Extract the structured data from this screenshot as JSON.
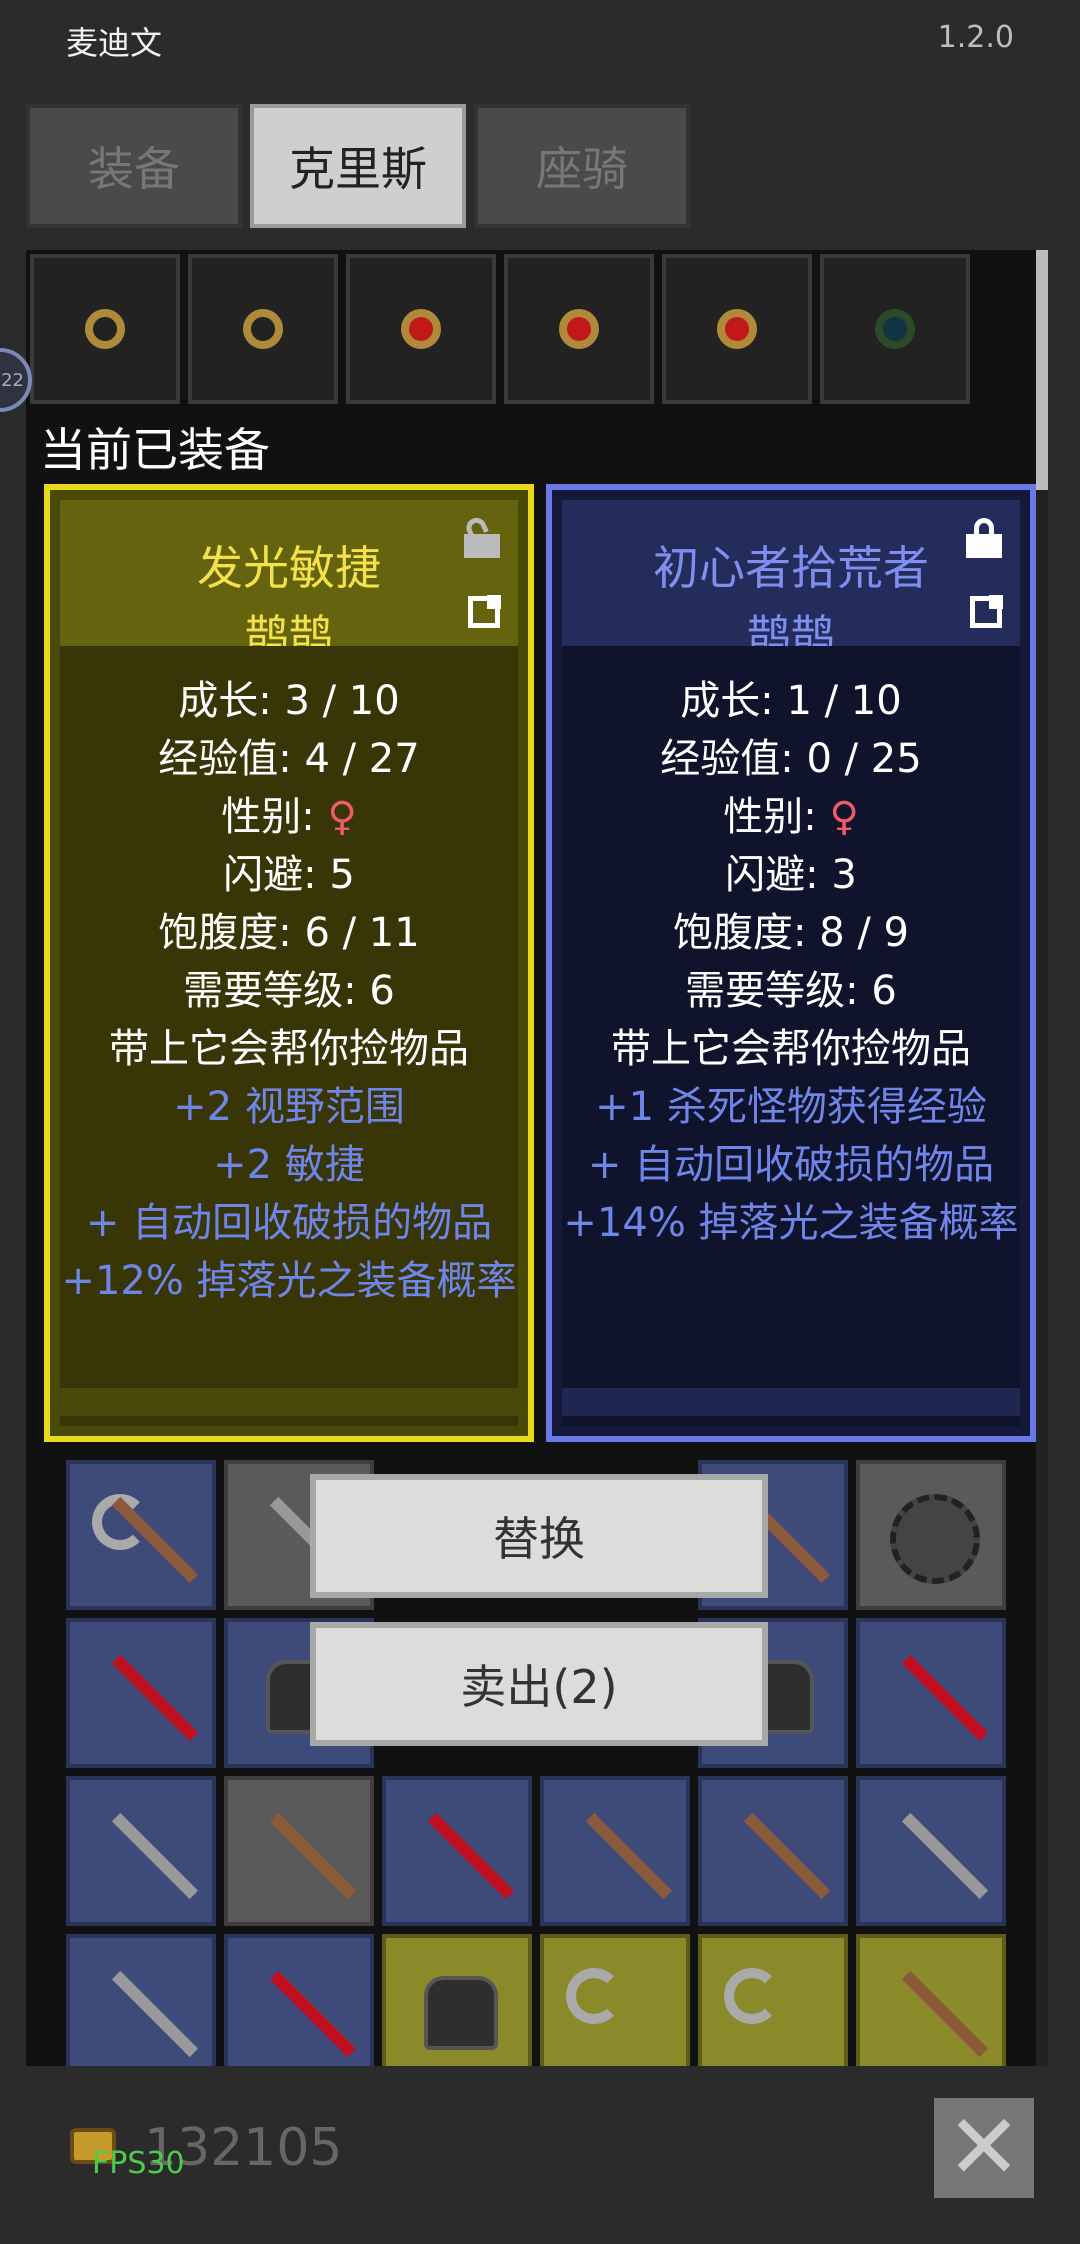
{
  "status": {
    "title": "麦迪文",
    "version": "1.2.0"
  },
  "tabs": [
    {
      "label": "装备",
      "active": false
    },
    {
      "label": "克里斯",
      "active": true
    },
    {
      "label": "座骑",
      "active": false
    }
  ],
  "badge": {
    "text": "22"
  },
  "heading": "当前已装备",
  "cards": {
    "left": {
      "title": "发光敏捷",
      "owner": "鹊鹊",
      "locked": false,
      "stats": {
        "growth": "成长: 3 / 10",
        "exp": "经验值: 4 / 27",
        "gender_label": "性别: ",
        "gender_symbol": "♀",
        "dodge": "闪避: 5",
        "satiety": "饱腹度: 6 / 11",
        "level": "需要等级: 6",
        "pickup": "带上它会帮你捡物品"
      },
      "bonuses": [
        "+2 视野范围",
        "+2 敏捷",
        "+ 自动回收破损的物品",
        "+12% 掉落光之装备概率"
      ]
    },
    "right": {
      "title": "初心者拾荒者",
      "owner": "鹊鹊",
      "locked": true,
      "stats": {
        "growth": "成长: 1 / 10",
        "exp": "经验值: 0 / 25",
        "gender_label": "性别: ",
        "gender_symbol": "♀",
        "dodge": "闪避: 3",
        "satiety": "饱腹度: 8 / 9",
        "level": "需要等级: 6",
        "pickup": "带上它会帮你捡物品"
      },
      "bonuses": [
        "+1 杀死怪物获得经验",
        "+ 自动回收破损的物品",
        "+14% 掉落光之装备概率"
      ]
    }
  },
  "actions": {
    "replace": "替换",
    "sell": "卖出(2)"
  },
  "footer": {
    "gold": "132105",
    "fps": "FPS30"
  },
  "colors": {
    "card_left_border": "#e8d91a",
    "card_right_border": "#6a78e8",
    "bonus_text": "#6f85e8",
    "female_symbol": "#f05a6a",
    "fps_text": "#4ccc4c"
  },
  "icons": [
    "open-lock-icon",
    "lock-icon",
    "export-icon",
    "coin-icon",
    "close-icon"
  ]
}
